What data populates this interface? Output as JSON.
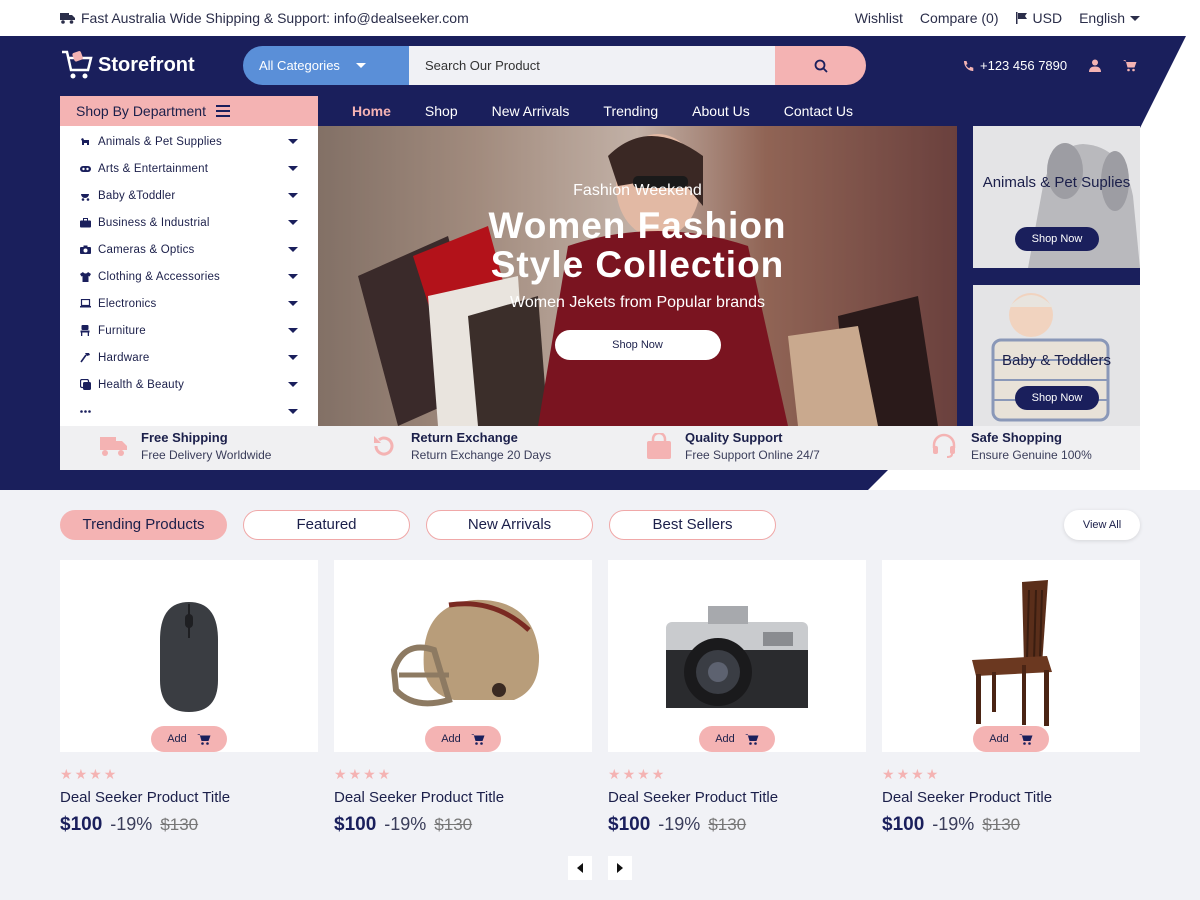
{
  "topbar": {
    "shipping_text": "Fast Australia Wide Shipping & Support: info@dealseeker.com",
    "wishlist": "Wishlist",
    "compare": "Compare (0)",
    "currency": "USD",
    "language": "English"
  },
  "header": {
    "logo_text": "Storefront",
    "category_label": "All Categories",
    "search_placeholder": "Search Our Product",
    "phone": "+123 456 7890"
  },
  "department": {
    "title": "Shop By Department",
    "items": [
      {
        "label": "Animals & Pet Supplies"
      },
      {
        "label": "Arts & Entertainment"
      },
      {
        "label": "Baby &Toddler"
      },
      {
        "label": "Business & Industrial"
      },
      {
        "label": "Cameras & Optics"
      },
      {
        "label": "Clothing & Accessories"
      },
      {
        "label": "Electronics"
      },
      {
        "label": "Furniture"
      },
      {
        "label": "Hardware"
      },
      {
        "label": "Health & Beauty"
      },
      {
        "label": ""
      }
    ]
  },
  "nav": {
    "items": [
      "Home",
      "Shop",
      "New Arrivals",
      "Trending",
      "About Us",
      "Contact Us"
    ]
  },
  "banner": {
    "kicker": "Fashion Weekend",
    "title_line1": "Women Fashion",
    "title_line2": "Style Collection",
    "subtitle": "Women Jekets from  Popular brands",
    "button": "Shop Now"
  },
  "promos": [
    {
      "title": "Animals & Pet Suplies",
      "button": "Shop Now"
    },
    {
      "title": "Baby & Toddlers",
      "button": "Shop Now"
    }
  ],
  "features": [
    {
      "title": "Free Shipping",
      "subtitle": "Free Delivery Worldwide"
    },
    {
      "title": "Return Exchange",
      "subtitle": "Return Exchange 20 Days"
    },
    {
      "title": "Quality Support",
      "subtitle": "Free Support Online 24/7"
    },
    {
      "title": "Safe Shopping",
      "subtitle": "Ensure Genuine 100%"
    }
  ],
  "tabs": [
    "Trending Products",
    "Featured",
    "New Arrivals",
    "Best Sellers"
  ],
  "view_all": "View All",
  "products": [
    {
      "title": "Deal Seeker Product Title",
      "price": "100",
      "discount": "-19%",
      "old_price": "$130",
      "add": "Add",
      "rating": 4,
      "image": "computer-mouse"
    },
    {
      "title": "Deal Seeker Product Title",
      "price": "100",
      "discount": "-19%",
      "old_price": "$130",
      "add": "Add",
      "rating": 4,
      "image": "football-helmet"
    },
    {
      "title": "Deal Seeker Product Title",
      "price": "100",
      "discount": "-19%",
      "old_price": "$130",
      "add": "Add",
      "rating": 4,
      "image": "film-camera"
    },
    {
      "title": "Deal Seeker Product Title",
      "price": "100",
      "discount": "-19%",
      "old_price": "$130",
      "add": "Add",
      "rating": 4,
      "image": "wooden-chair"
    }
  ],
  "currency_symbol": "$",
  "colors": {
    "navy": "#1a1f5c",
    "pink": "#f4b3b3",
    "blue": "#5a8fd8"
  }
}
